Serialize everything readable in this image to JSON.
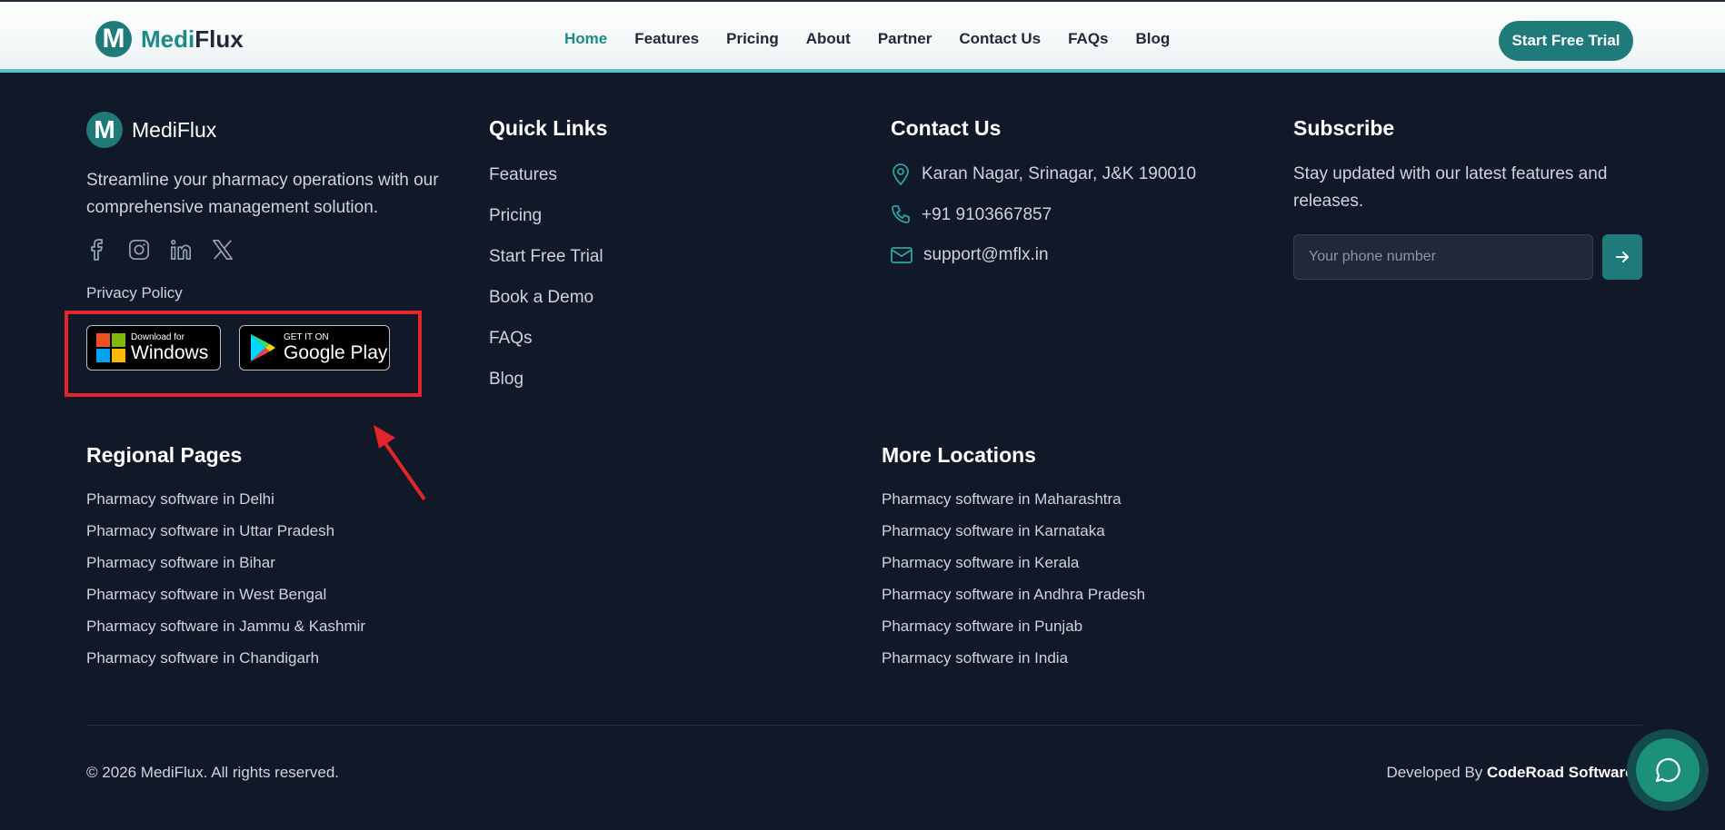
{
  "header": {
    "brand_prefix": "Medi",
    "brand_suffix": "Flux",
    "nav": [
      "Home",
      "Features",
      "Pricing",
      "About",
      "Partner",
      "Contact Us",
      "FAQs",
      "Blog"
    ],
    "cta_label": "Start Free Trial"
  },
  "footer": {
    "brand": "MediFlux",
    "tagline": "Streamline your pharmacy operations with our comprehensive management solution.",
    "socials": [
      "facebook-icon",
      "instagram-icon",
      "linkedin-icon",
      "x-icon"
    ],
    "privacy": "Privacy Policy",
    "store": {
      "windows_small": "Download for",
      "windows_big": "Windows",
      "gp_small": "GET IT ON",
      "gp_big": "Google Play"
    },
    "quick_links": {
      "title": "Quick Links",
      "items": [
        "Features",
        "Pricing",
        "Start Free Trial",
        "Book a Demo",
        "FAQs",
        "Blog"
      ]
    },
    "contact": {
      "title": "Contact Us",
      "address": "Karan Nagar, Srinagar, J&K 190010",
      "phone": "+91 9103667857",
      "email": "support@mflx.in"
    },
    "subscribe": {
      "title": "Subscribe",
      "text": "Stay updated with our latest features and releases.",
      "placeholder": "Your phone number"
    },
    "regional": {
      "title": "Regional Pages",
      "items": [
        "Pharmacy software in Delhi",
        "Pharmacy software in Uttar Pradesh",
        "Pharmacy software in Bihar",
        "Pharmacy software in West Bengal",
        "Pharmacy software in Jammu & Kashmir",
        "Pharmacy software in Chandigarh"
      ]
    },
    "more_locations": {
      "title": "More Locations",
      "items": [
        "Pharmacy software in Maharashtra",
        "Pharmacy software in Karnataka",
        "Pharmacy software in Kerala",
        "Pharmacy software in Andhra Pradesh",
        "Pharmacy software in Punjab",
        "Pharmacy software in India"
      ]
    },
    "copyright": "© 2026 MediFlux. All rights reserved.",
    "developed_by": "Developed By",
    "developer": "CodeRoad Softwares"
  },
  "colors": {
    "accent": "#1f7a7a",
    "background": "#111827",
    "annotation": "#e3252b",
    "chat": "#1a9178"
  }
}
